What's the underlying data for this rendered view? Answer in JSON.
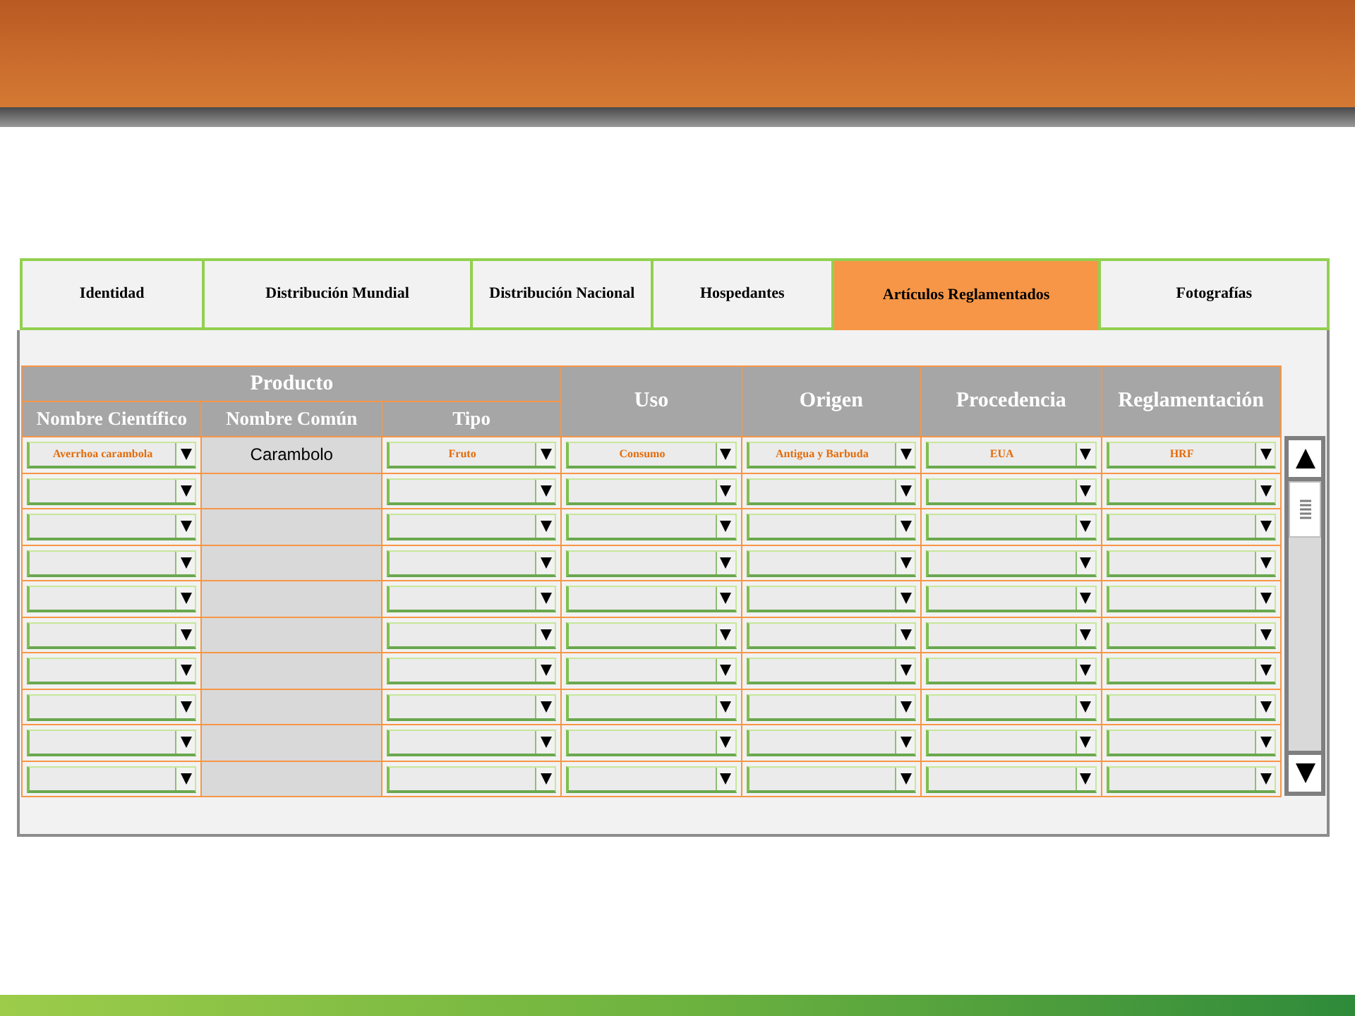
{
  "tabs": [
    {
      "label": "Identidad",
      "selected": false
    },
    {
      "label": "Distribución Mundial",
      "selected": false
    },
    {
      "label": "Distribución Nacional",
      "selected": false
    },
    {
      "label": "Hospedantes",
      "selected": false
    },
    {
      "label": "Artículos Reglamentados",
      "selected": true
    },
    {
      "label": "Fotografías",
      "selected": false
    }
  ],
  "table": {
    "group_header": "Producto",
    "columns": [
      {
        "label": "Nombre Científico",
        "kind": "dropdown",
        "grouped": true
      },
      {
        "label": "Nombre Común",
        "kind": "text",
        "grouped": true
      },
      {
        "label": "Tipo",
        "kind": "dropdown",
        "grouped": true
      },
      {
        "label": "Uso",
        "kind": "dropdown",
        "grouped": false
      },
      {
        "label": "Origen",
        "kind": "dropdown",
        "grouped": false
      },
      {
        "label": "Procedencia",
        "kind": "dropdown",
        "grouped": false
      },
      {
        "label": "Reglamentación",
        "kind": "dropdown",
        "grouped": false
      }
    ],
    "rows": [
      {
        "kind": "filled",
        "values": [
          "Averrhoa carambola",
          "Carambolo",
          "Fruto",
          "Consumo",
          "Antigua y Barbuda",
          "EUA",
          "HRF"
        ]
      },
      {
        "kind": "empty"
      },
      {
        "kind": "empty"
      },
      {
        "kind": "empty"
      },
      {
        "kind": "empty"
      },
      {
        "kind": "empty"
      },
      {
        "kind": "empty"
      },
      {
        "kind": "empty"
      },
      {
        "kind": "empty"
      },
      {
        "kind": "empty"
      }
    ]
  }
}
